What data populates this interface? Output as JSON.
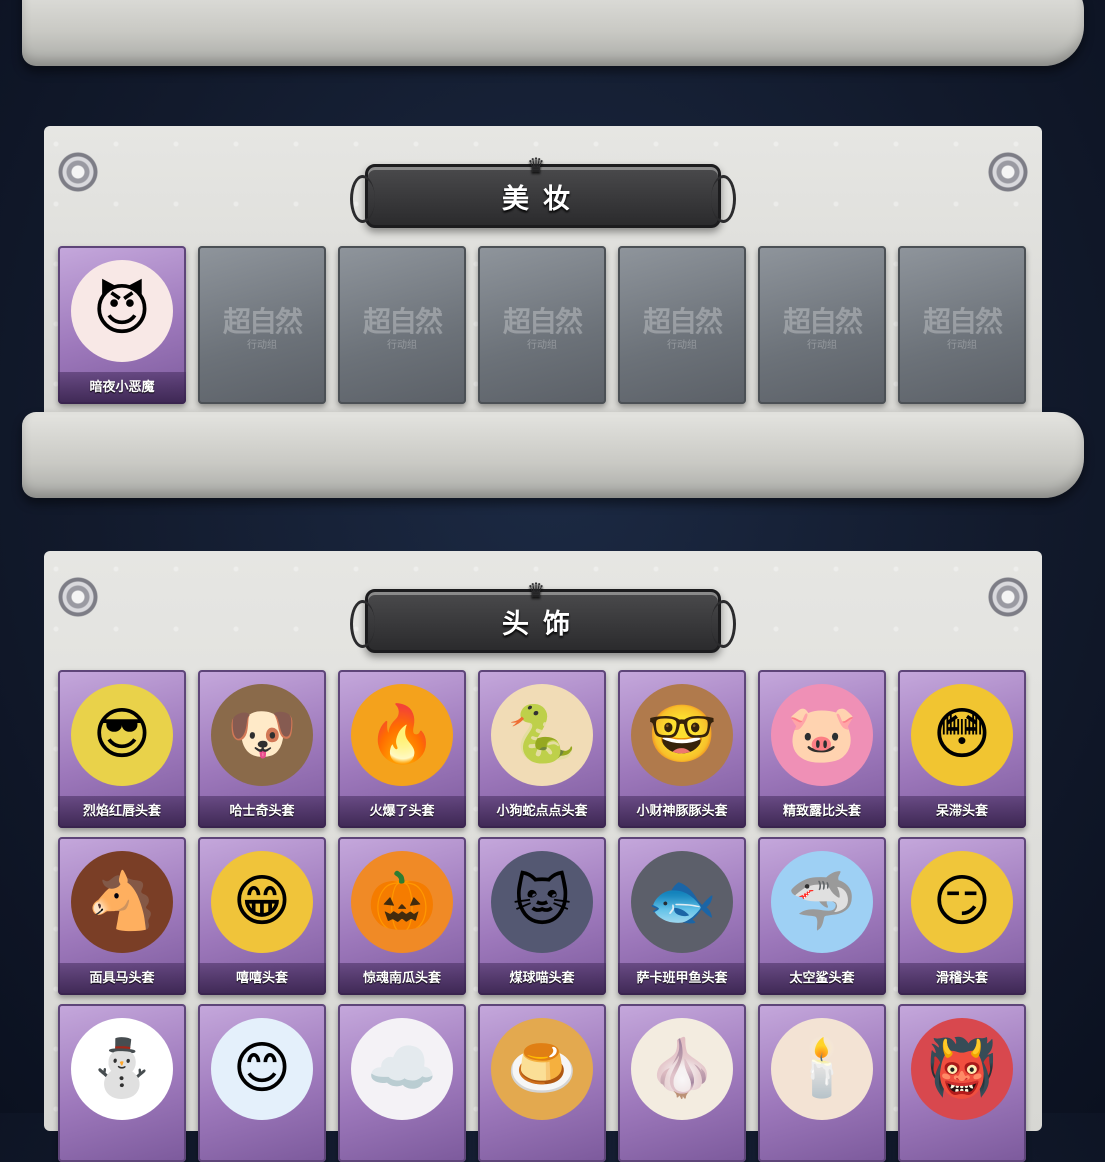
{
  "sections": {
    "makeup": {
      "title": "美妆",
      "items": [
        {
          "label": "暗夜小恶魔",
          "icon": "devil-face-icon"
        }
      ],
      "placeholder_watermark": "超自然",
      "placeholder_sub": "行动组"
    },
    "headwear": {
      "title": "头饰",
      "items": [
        {
          "label": "烈焰红唇头套",
          "icon": "pikachu-mask-icon",
          "glyph": "😎"
        },
        {
          "label": "哈士奇头套",
          "icon": "husky-mask-icon",
          "glyph": "🐶"
        },
        {
          "label": "火爆了头套",
          "icon": "fire-mask-icon",
          "glyph": "🔥"
        },
        {
          "label": "小狗蛇点点头套",
          "icon": "snake-mask-icon",
          "glyph": "🐍"
        },
        {
          "label": "小财神豚豚头套",
          "icon": "capybara-mask-icon",
          "glyph": "🤓"
        },
        {
          "label": "精致露比头套",
          "icon": "loopy-mask-icon",
          "glyph": "🐷"
        },
        {
          "label": "呆滞头套",
          "icon": "dazed-face-mask-icon",
          "glyph": "😳"
        },
        {
          "label": "面具马头套",
          "icon": "horse-mask-icon",
          "glyph": "🐴"
        },
        {
          "label": "嘻嘻头套",
          "icon": "grin-face-mask-icon",
          "glyph": "😁"
        },
        {
          "label": "惊魂南瓜头套",
          "icon": "pumpkin-mask-icon",
          "glyph": "🎃"
        },
        {
          "label": "煤球喵头套",
          "icon": "cat-mask-icon",
          "glyph": "🐱"
        },
        {
          "label": "萨卡班甲鱼头套",
          "icon": "fish-mask-icon",
          "glyph": "🐟"
        },
        {
          "label": "太空鲨头套",
          "icon": "shark-mask-icon",
          "glyph": "🦈"
        },
        {
          "label": "滑稽头套",
          "icon": "funny-face-mask-icon",
          "glyph": "😏"
        },
        {
          "label": "",
          "icon": "snowman-mask-icon",
          "glyph": "⛄"
        },
        {
          "label": "",
          "icon": "dumpling-mask-icon",
          "glyph": "😊"
        },
        {
          "label": "",
          "icon": "cloud-mask-icon",
          "glyph": "☁️"
        },
        {
          "label": "",
          "icon": "pudding-mask-icon",
          "glyph": "🍮"
        },
        {
          "label": "",
          "icon": "garlic-mask-icon",
          "glyph": "🧄"
        },
        {
          "label": "",
          "icon": "candle-mask-icon",
          "glyph": "🕯️"
        },
        {
          "label": "",
          "icon": "red-creature-mask-icon",
          "glyph": "👹"
        }
      ]
    }
  }
}
